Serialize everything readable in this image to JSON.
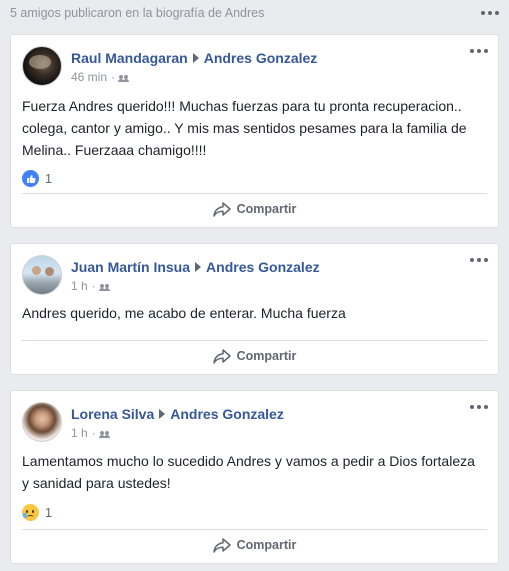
{
  "header": {
    "title": "5 amigos publicaron en la biografía de Andres",
    "more_icon": "more-horizontal-icon"
  },
  "posts": [
    {
      "author": "Raul Mandagaran",
      "target": "Andres Gonzalez",
      "time": "46 min",
      "separator": "·",
      "text_lines": [
        "Fuerza Andres querido!!! Muchas fuerzas para tu pronta recuperacion..",
        "colega, cantor y amigo.. Y mis mas sentidos pesames para la familia de",
        "Melina.. Fuerzaaa chamigo!!!!"
      ],
      "reaction": {
        "type": "like-icon",
        "count": "1"
      },
      "share_label": "Compartir"
    },
    {
      "author": "Juan Martín Insua",
      "target": "Andres Gonzalez",
      "time": "1 h",
      "separator": "·",
      "text_lines": [
        "Andres querido, me acabo de enterar. Mucha fuerza"
      ],
      "share_label": "Compartir"
    },
    {
      "author": "Lorena Silva",
      "target": "Andres Gonzalez",
      "time": "1 h",
      "separator": "·",
      "text_lines": [
        "Lamentamos mucho lo sucedido Andres y vamos a pedir a Dios fortaleza",
        "y sanidad para ustedes!"
      ],
      "reaction": {
        "type": "sad-icon",
        "count": "1"
      },
      "share_label": "Compartir"
    }
  ],
  "colors": {
    "link": "#365899",
    "text": "#1d2129",
    "muted": "#90949c",
    "like": "#4080ff"
  }
}
